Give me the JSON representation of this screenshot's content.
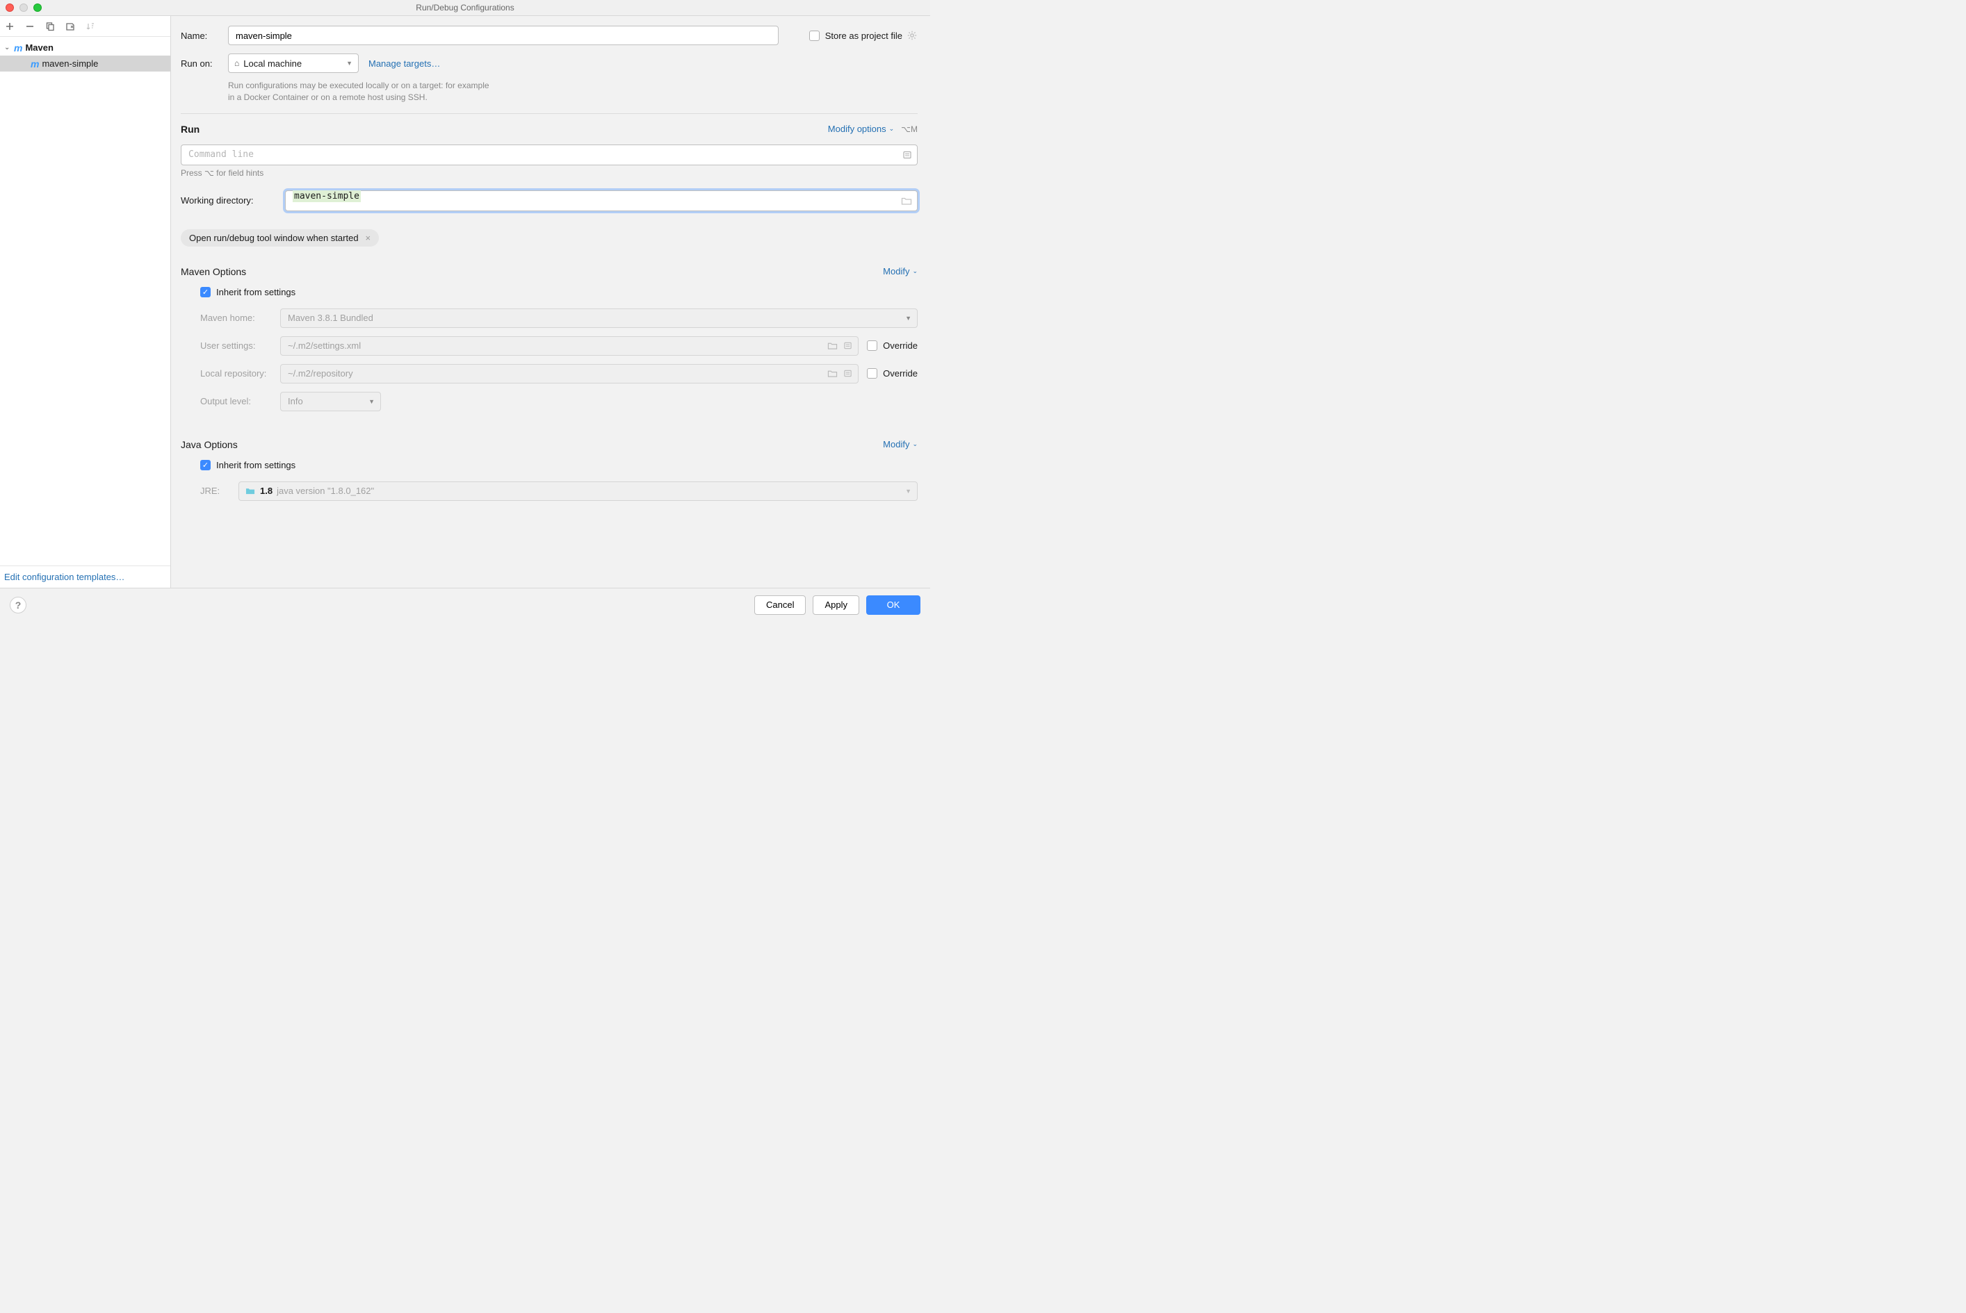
{
  "titlebar": {
    "title": "Run/Debug Configurations"
  },
  "sidebar": {
    "group": "Maven",
    "item": "maven-simple",
    "footer_link": "Edit configuration templates…"
  },
  "form": {
    "name_label": "Name:",
    "name_value": "maven-simple",
    "store_label": "Store as project file",
    "run_on_label": "Run on:",
    "run_on_value": "Local machine",
    "manage_targets": "Manage targets…",
    "run_on_hint1": "Run configurations may be executed locally or on a target: for example",
    "run_on_hint2": "in a Docker Container or on a remote host using SSH."
  },
  "run": {
    "title": "Run",
    "modify_label": "Modify options",
    "shortcut": "⌥M",
    "cmd_placeholder": "Command line",
    "cmd_hint": "Press ⌥ for field hints",
    "wd_label": "Working directory:",
    "wd_value": "maven-simple",
    "chip": "Open run/debug tool window when started"
  },
  "maven": {
    "title": "Maven Options",
    "modify_label": "Modify",
    "inherit": "Inherit from settings",
    "home_label": "Maven home:",
    "home_value": "Maven 3.8.1 Bundled",
    "user_label": "User settings:",
    "user_value": "~/.m2/settings.xml",
    "local_label": "Local repository:",
    "local_value": "~/.m2/repository",
    "override": "Override",
    "output_label": "Output level:",
    "output_value": "Info"
  },
  "java": {
    "title": "Java Options",
    "modify_label": "Modify",
    "inherit": "Inherit from settings",
    "jre_label": "JRE:",
    "jre_ver": "1.8",
    "jre_desc": "java version \"1.8.0_162\""
  },
  "footer": {
    "cancel": "Cancel",
    "apply": "Apply",
    "ok": "OK"
  }
}
